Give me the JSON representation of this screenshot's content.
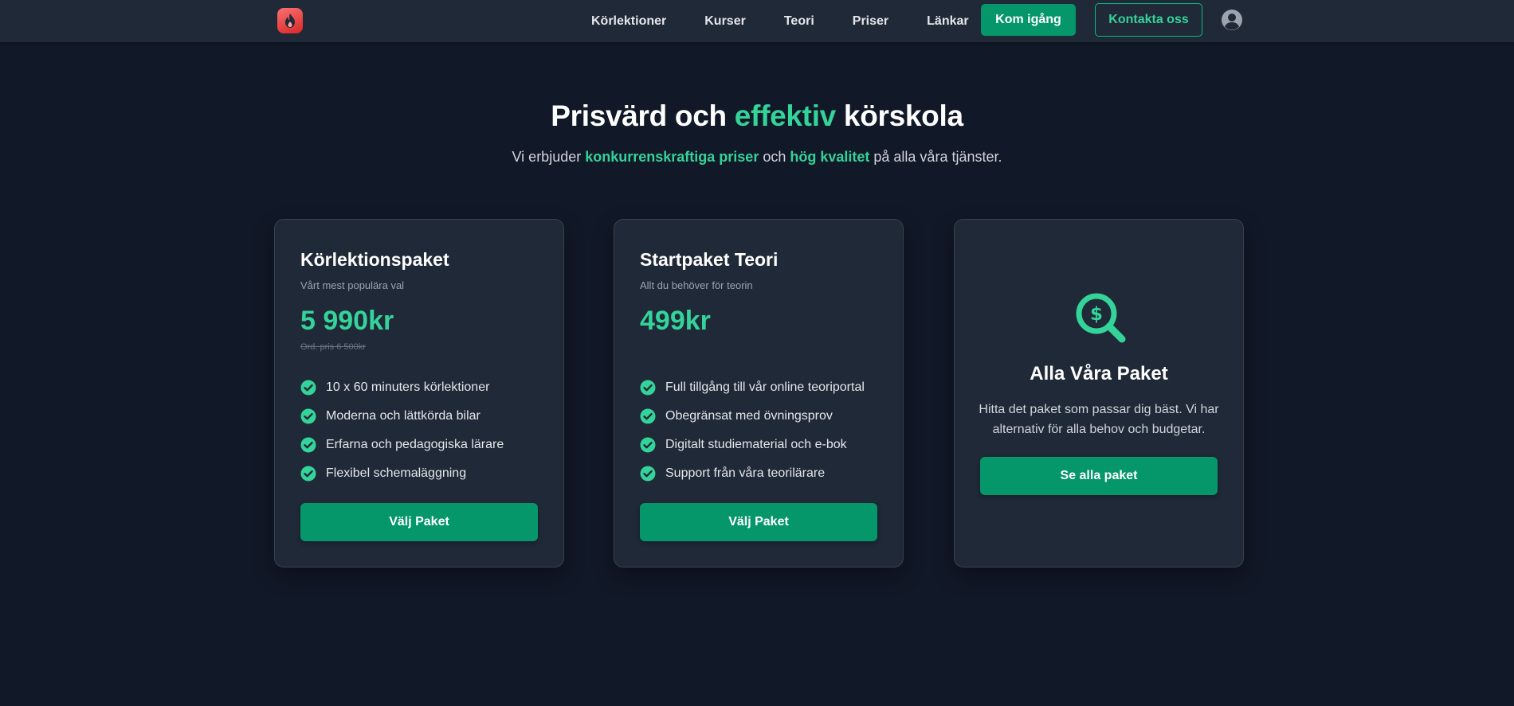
{
  "navbar": {
    "logo_icon": "flame-icon",
    "links": [
      "Körlektioner",
      "Kurser",
      "Teori",
      "Priser",
      "Länkar"
    ],
    "cta_primary": "Kom igång",
    "cta_secondary": "Kontakta oss",
    "user_icon": "user-circle-icon"
  },
  "hero": {
    "title_pre": "Prisvärd och ",
    "title_accent": "effektiv",
    "title_post": " körskola",
    "sub_pre": "Vi erbjuder ",
    "sub_accent1": "konkurrenskraftiga priser",
    "sub_mid": " och ",
    "sub_accent2": "hög kvalitet",
    "sub_post": " på alla våra tjänster."
  },
  "cards": [
    {
      "title": "Körlektionspaket",
      "tagline": "Vårt mest populära val",
      "price": "5 990kr",
      "old_price": "Ord. pris 6 500kr",
      "features": [
        "10 x 60 minuters körlektioner",
        "Moderna och lättkörda bilar",
        "Erfarna och pedagogiska lärare",
        "Flexibel schemaläggning"
      ],
      "button": "Välj Paket"
    },
    {
      "title": "Startpaket Teori",
      "tagline": "Allt du behöver för teorin",
      "price": "499kr",
      "features": [
        "Full tillgång till vår online teoriportal",
        "Obegränsat med övningsprov",
        "Digitalt studiematerial och e-bok",
        "Support från våra teorilärare"
      ],
      "button": "Välj Paket"
    },
    {
      "icon": "search-dollar-icon",
      "title": "Alla Våra Paket",
      "description": "Hitta det paket som passar dig bäst. Vi har alternativ för alla behov och budgetar.",
      "button": "Se alla paket"
    }
  ],
  "colors": {
    "background": "#111827",
    "navbar": "#1f2937",
    "card": "#1f2937",
    "accent": "#34d399",
    "button": "#059669"
  }
}
